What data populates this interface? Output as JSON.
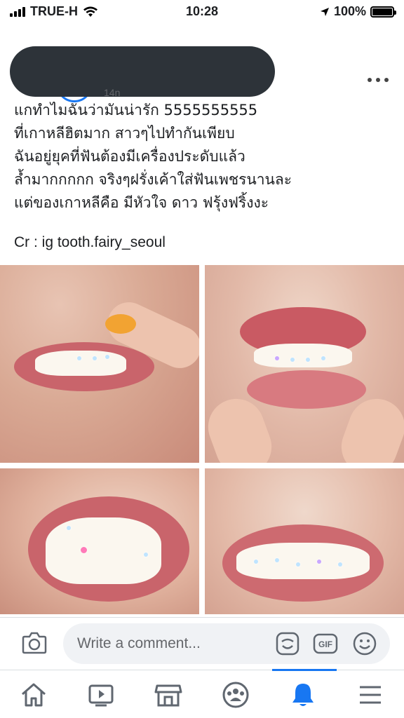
{
  "status_bar": {
    "carrier": "TRUE-H",
    "time": "10:28",
    "battery": "100%"
  },
  "post": {
    "author_redacted": true,
    "meta": "14n",
    "caption_lines": [
      "แกทำไมฉันว่ามันน่ารัก 5555555555",
      "ที่เกาหลีฮิตมาก สาวๆไปทำกันเพียบ",
      "ฉันอยู่ยุคที่ฟันต้องมีเครื่องประดับแล้ว",
      "ล้ำมากกกกก จริงๆฝรั่งเค้าใส่ฟันเพชรนานละ",
      "แต่ของเกาหลีคือ มีหัวใจ ดาว ฟรุ้งฟริ้งงะ"
    ],
    "credit": "Cr : ig tooth.fairy_seoul",
    "photos": [
      "tooth-gem-photo-1",
      "tooth-gem-photo-2",
      "tooth-gem-photo-3",
      "tooth-gem-photo-4"
    ]
  },
  "comment_bar": {
    "placeholder": "Write a comment...",
    "gif_label": "GIF"
  },
  "bottom_nav": {
    "items": [
      "home-icon",
      "watch-icon",
      "marketplace-icon",
      "groups-icon",
      "notifications-icon",
      "menu-icon"
    ],
    "active": "notifications-icon",
    "accent_color": "#1877f2"
  }
}
